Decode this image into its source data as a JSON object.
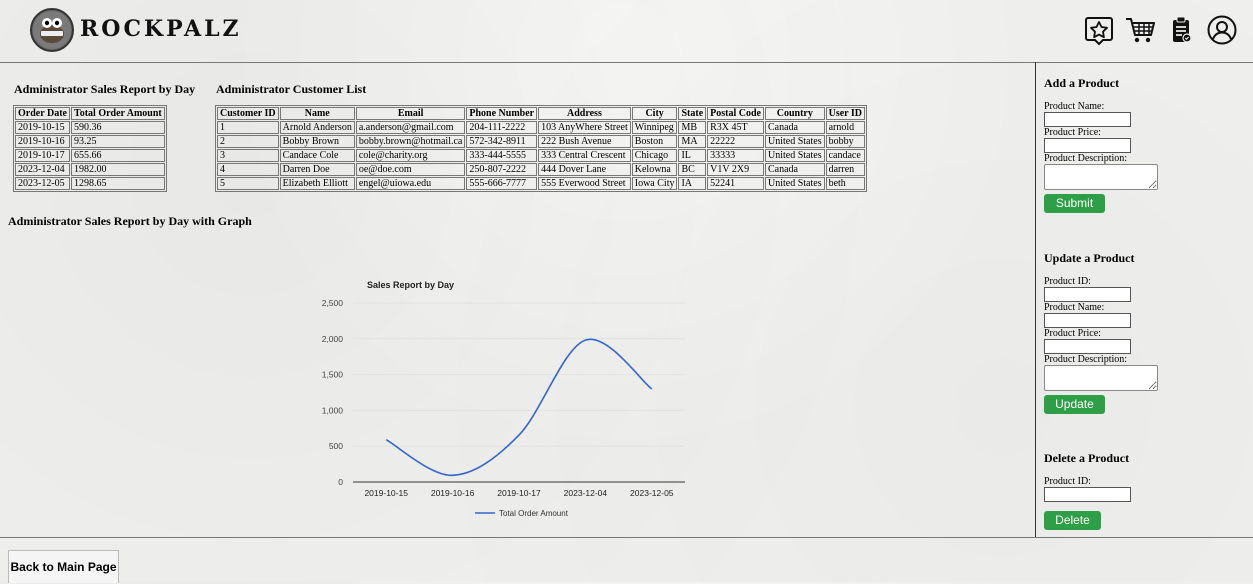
{
  "header": {
    "brand": "ROCKPALZ",
    "icons": [
      "star-list-icon",
      "cart-icon",
      "clipboard-icon",
      "user-icon"
    ]
  },
  "sales_report": {
    "title": "Administrator Sales Report by Day",
    "columns": [
      "Order Date",
      "Total Order Amount"
    ],
    "rows": [
      [
        "2019-10-15",
        "590.36"
      ],
      [
        "2019-10-16",
        "93.25"
      ],
      [
        "2019-10-17",
        "655.66"
      ],
      [
        "2023-12-04",
        "1982.00"
      ],
      [
        "2023-12-05",
        "1298.65"
      ]
    ]
  },
  "customer_list": {
    "title": "Administrator Customer List",
    "columns": [
      "Customer ID",
      "Name",
      "Email",
      "Phone Number",
      "Address",
      "City",
      "State",
      "Postal Code",
      "Country",
      "User ID"
    ],
    "rows": [
      [
        "1",
        "Arnold Anderson",
        "a.anderson@gmail.com",
        "204-111-2222",
        "103 AnyWhere Street",
        "Winnipeg",
        "MB",
        "R3X 45T",
        "Canada",
        "arnold"
      ],
      [
        "2",
        "Bobby Brown",
        "bobby.brown@hotmail.ca",
        "572-342-8911",
        "222 Bush Avenue",
        "Boston",
        "MA",
        "22222",
        "United States",
        "bobby"
      ],
      [
        "3",
        "Candace Cole",
        "cole@charity.org",
        "333-444-5555",
        "333 Central Crescent",
        "Chicago",
        "IL",
        "33333",
        "United States",
        "candace"
      ],
      [
        "4",
        "Darren Doe",
        "oe@doe.com",
        "250-807-2222",
        "444 Dover Lane",
        "Kelowna",
        "BC",
        "V1V 2X9",
        "Canada",
        "darren"
      ],
      [
        "5",
        "Elizabeth Elliott",
        "engel@uiowa.edu",
        "555-666-7777",
        "555 Everwood Street",
        "Iowa City",
        "IA",
        "52241",
        "United States",
        "beth"
      ]
    ]
  },
  "graph_section": {
    "title": "Administrator Sales Report by Day with Graph"
  },
  "chart_data": {
    "type": "line",
    "title": "Sales Report by Day",
    "categories": [
      "2019-10-15",
      "2019-10-16",
      "2019-10-17",
      "2023-12-04",
      "2023-12-05"
    ],
    "series": [
      {
        "name": "Total Order Amount",
        "values": [
          590.36,
          93.25,
          655.66,
          1982.0,
          1298.65
        ],
        "color": "#3366cc"
      }
    ],
    "ylim": [
      0,
      2500
    ],
    "yticks": [
      0,
      500,
      1000,
      1500,
      2000,
      2500
    ],
    "ytick_labels": [
      "0",
      "500",
      "1,000",
      "1,500",
      "2,000",
      "2,500"
    ],
    "grid": true,
    "legend": "bottom",
    "xlabel": "",
    "ylabel": ""
  },
  "sidebar": {
    "add": {
      "title": "Add a Product",
      "name_label": "Product Name:",
      "price_label": "Product Price:",
      "desc_label": "Product Description:",
      "button": "Submit"
    },
    "update": {
      "title": "Update a Product",
      "id_label": "Product ID:",
      "name_label": "Product Name:",
      "price_label": "Product Price:",
      "desc_label": "Product Description:",
      "button": "Update"
    },
    "delete": {
      "title": "Delete a Product",
      "id_label": "Product ID:",
      "button": "Delete"
    },
    "button_color": "#2e9e47"
  },
  "footer": {
    "back_label": "Back to Main Page"
  }
}
